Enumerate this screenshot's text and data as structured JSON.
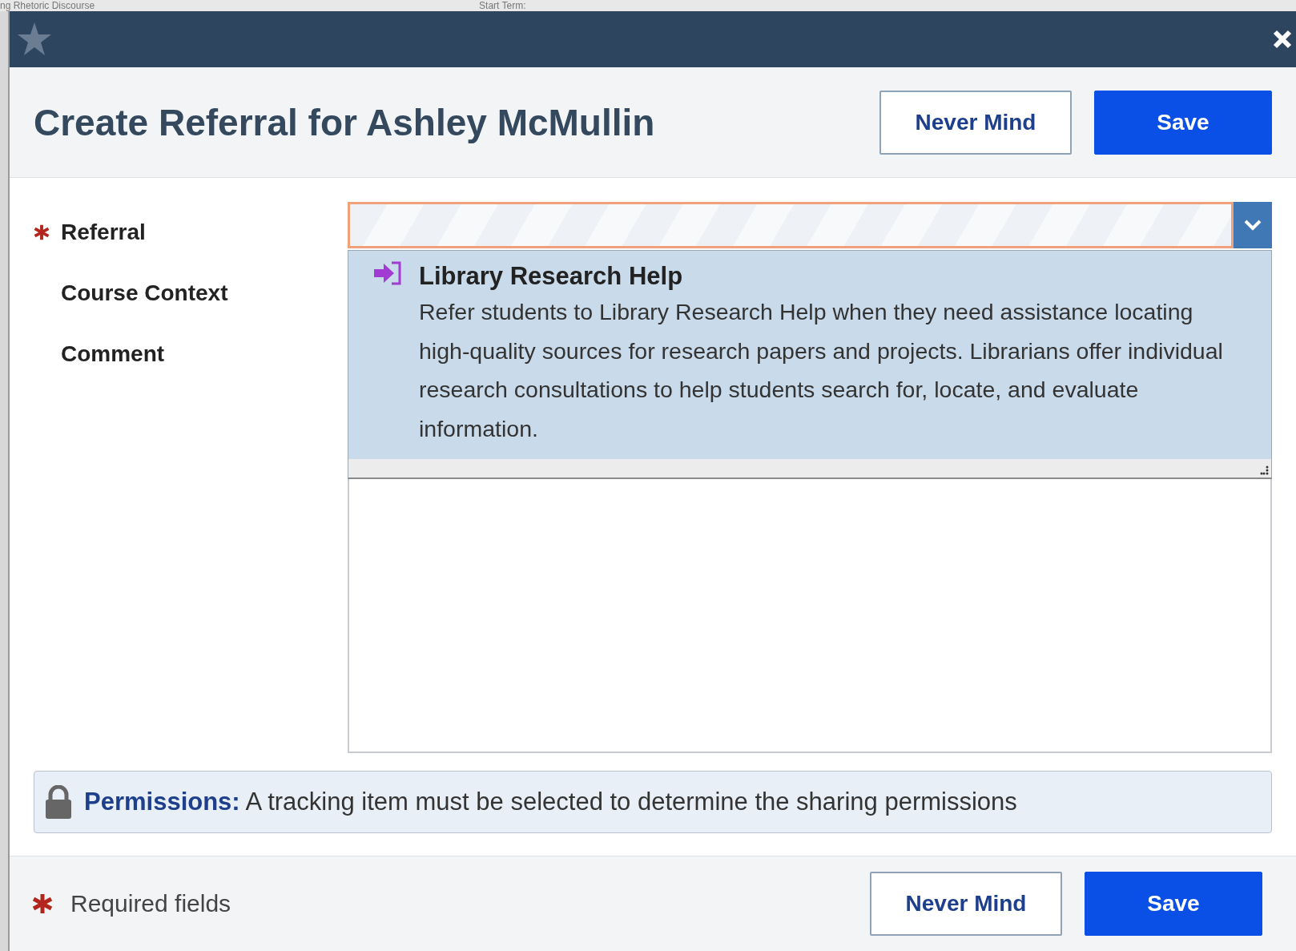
{
  "background": {
    "texts": [
      "ng Rhetoric Discourse",
      "Start Term:"
    ]
  },
  "dialog": {
    "title": "Create Referral for Ashley McMullin",
    "header_buttons": [
      {
        "label": "Never Mind",
        "kind": "secondary"
      },
      {
        "label": "Save",
        "kind": "primary"
      }
    ],
    "fields": [
      {
        "label": "Referral",
        "required": true
      },
      {
        "label": "Course Context",
        "required": false
      },
      {
        "label": "Comment",
        "required": false
      }
    ],
    "referral_dropdown": {
      "expanded": true,
      "options": [
        {
          "title": "Library Research Help",
          "description": "Refer students to Library Research Help when they need assistance locating high-quality sources for research papers and projects. Librarians offer individual research consultations to help students search for, locate, and evaluate information.",
          "selected": true
        }
      ]
    },
    "permissions": {
      "text": "**Permissions:** A tracking item must be selected to determine the sharing permissions"
    },
    "footer": {
      "required_note": "Required fields",
      "buttons": [
        {
          "label": "Never Mind",
          "kind": "secondary"
        },
        {
          "label": "Save",
          "kind": "primary"
        }
      ]
    }
  }
}
